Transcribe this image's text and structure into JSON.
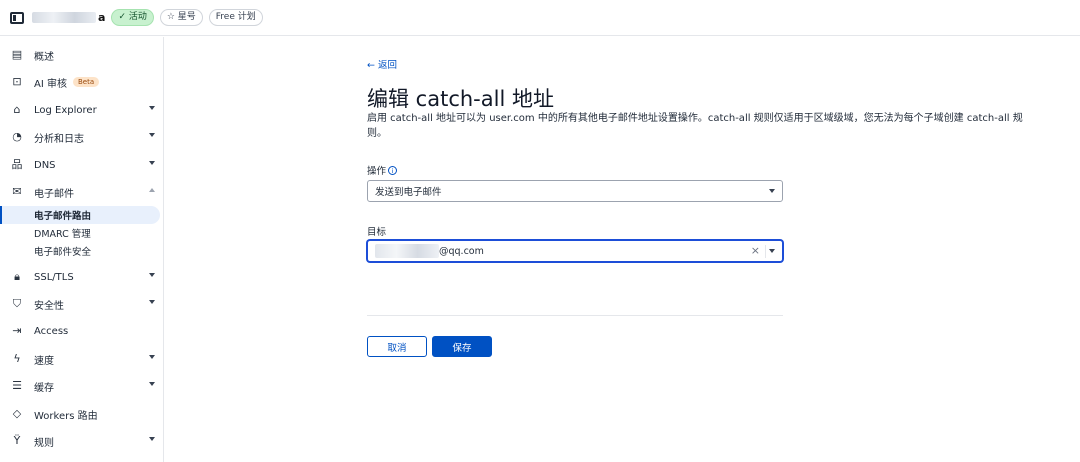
{
  "topbar": {
    "domain_suffix": "a",
    "status_badge": "✓ 活动",
    "star_badge": "☆ 星号",
    "plan_badge": "Free 计划"
  },
  "sidebar": {
    "items": [
      {
        "label": "概述",
        "icon": "document-icon"
      },
      {
        "label": "AI 审核",
        "icon": "ai-audit-icon",
        "badge": "Beta"
      },
      {
        "label": "Log Explorer",
        "icon": "log-explorer-icon"
      },
      {
        "label": "分析和日志",
        "icon": "analytics-icon"
      },
      {
        "label": "DNS",
        "icon": "dns-icon"
      },
      {
        "label": "电子邮件",
        "icon": "email-icon"
      },
      {
        "label": "SSL/TLS",
        "icon": "lock-icon"
      },
      {
        "label": "安全性",
        "icon": "shield-icon"
      },
      {
        "label": "Access",
        "icon": "access-icon"
      },
      {
        "label": "速度",
        "icon": "lightning-icon"
      },
      {
        "label": "缓存",
        "icon": "cache-icon"
      },
      {
        "label": "Workers 路由",
        "icon": "workers-icon"
      },
      {
        "label": "规则",
        "icon": "rules-icon"
      }
    ],
    "email_subitems": [
      "电子邮件路由",
      "DMARC 管理",
      "电子邮件安全"
    ]
  },
  "main": {
    "back_label": "← 返回",
    "title": "编辑 catch-all 地址",
    "description": "启用 catch-all 地址可以为 user.com 中的所有其他电子邮件地址设置操作。catch-all 规则仅适用于区域级域，您无法为每个子域创建 catch-all 规则。",
    "action_label": "操作",
    "action_value": "发送到电子邮件",
    "target_label": "目标",
    "target_value_visible": "@qq.com",
    "cancel_label": "取消",
    "save_label": "保存"
  },
  "colors": {
    "accent": "#0051c3",
    "active_badge": "#c8f1cf"
  }
}
